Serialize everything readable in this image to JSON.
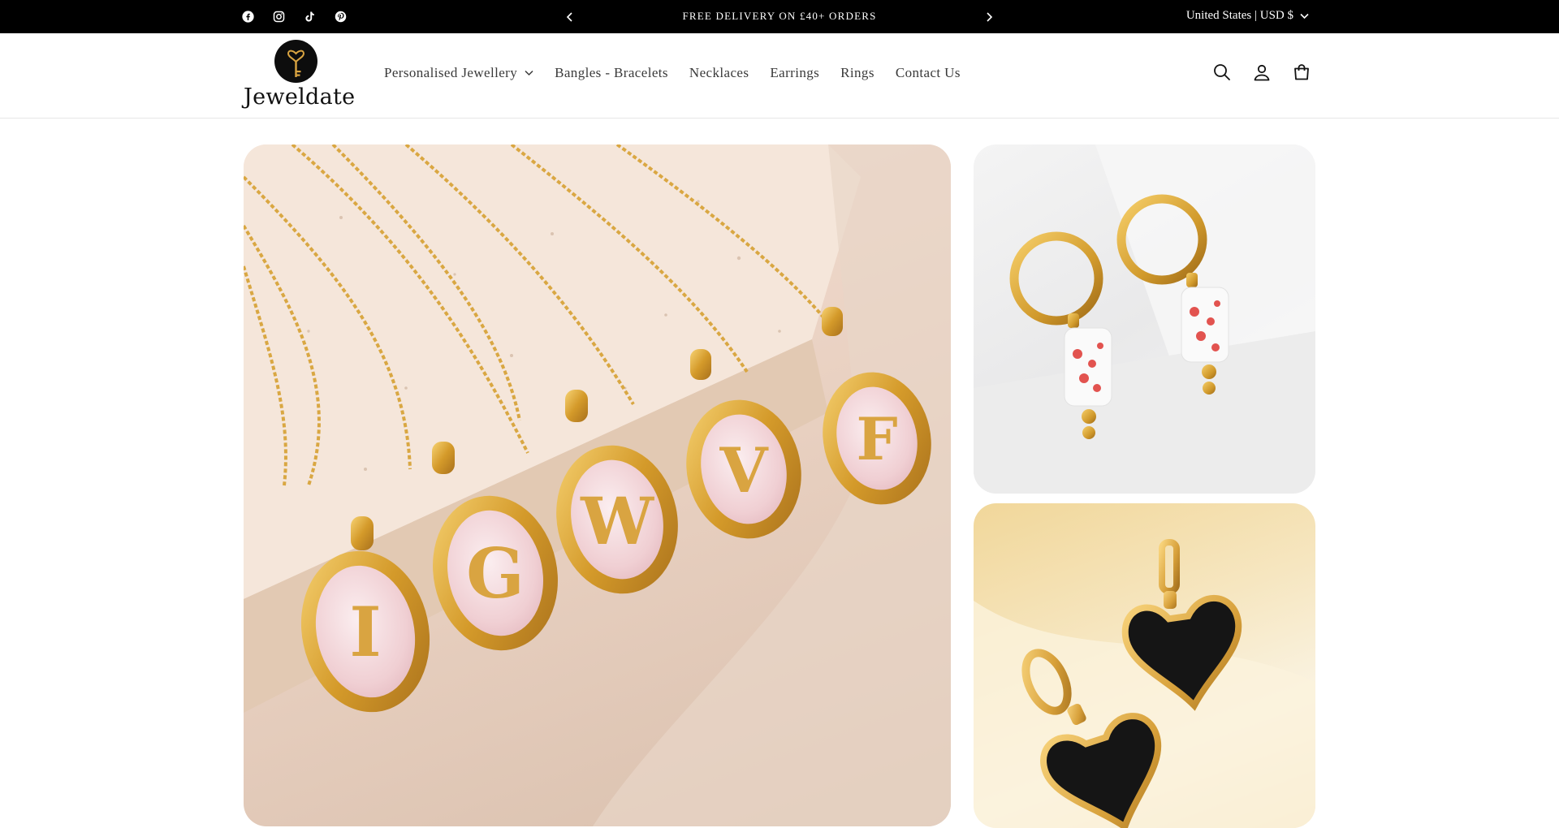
{
  "announcement": {
    "text": "FREE DELIVERY ON £40+ ORDERS",
    "locale": "United States | USD $"
  },
  "social_icons": [
    "facebook-icon",
    "instagram-icon",
    "tiktok-icon",
    "pinterest-icon"
  ],
  "brand": {
    "name": "Jeweldate"
  },
  "nav": {
    "items": [
      {
        "label": "Personalised Jewellery",
        "has_dropdown": true
      },
      {
        "label": "Bangles - Bracelets"
      },
      {
        "label": "Necklaces"
      },
      {
        "label": "Earrings"
      },
      {
        "label": "Rings"
      },
      {
        "label": "Contact Us"
      }
    ]
  },
  "header_icons": [
    "search-icon",
    "account-icon",
    "cart-icon"
  ],
  "gallery": {
    "pendant_letters": [
      "I",
      "G",
      "W",
      "V",
      "F"
    ]
  },
  "colors": {
    "announcement_bg": "#000000",
    "gold": "#d9a441",
    "enamel_pink": "#f1d6d6",
    "heart_black": "#151515"
  }
}
